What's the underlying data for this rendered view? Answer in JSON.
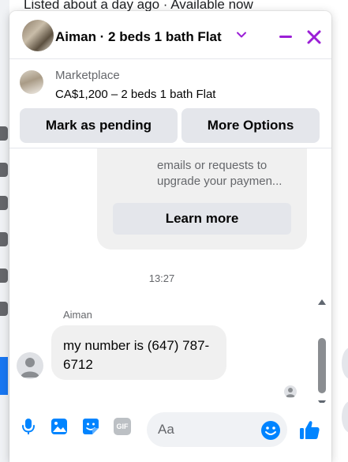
{
  "background": {
    "listing_status": "Listed about a day ago · Available now"
  },
  "header": {
    "title": "Aiman · 2 beds 1 bath Flat",
    "accent_color": "#9b1fd6"
  },
  "listing": {
    "source": "Marketplace",
    "price_title": "CA$1,200 – 2 beds 1 bath Flat",
    "mark_pending_label": "Mark as pending",
    "more_options_label": "More Options"
  },
  "messages": {
    "system_text": "emails or requests to upgrade your paymen...",
    "learn_more_label": "Learn more",
    "timestamp": "13:27",
    "sender_name": "Aiman",
    "message_text": "my number is (647) 787-6712"
  },
  "composer": {
    "placeholder": "Aa",
    "icons": [
      "microphone-icon",
      "photo-icon",
      "sticker-icon",
      "gif-icon",
      "emoji-icon",
      "thumbs-up-icon"
    ],
    "gif_label": "GIF",
    "icon_color": "#0084ff"
  }
}
